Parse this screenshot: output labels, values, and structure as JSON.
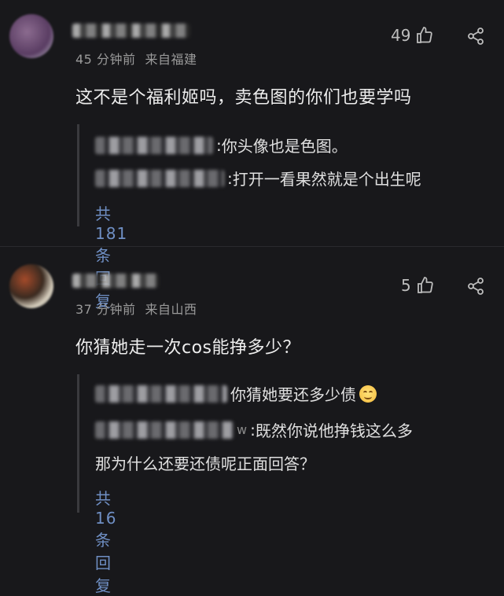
{
  "comments": [
    {
      "time": "45 分钟前",
      "location": "来自福建",
      "likes": "49",
      "text": "这不是个福利姬吗，卖色图的你们也要学吗",
      "replies": [
        {
          "text": "你头像也是色图。"
        },
        {
          "text": "打开一看果然就是个出生呢"
        }
      ],
      "more_replies": "共181条回复"
    },
    {
      "time": "37 分钟前",
      "location": "来自山西",
      "likes": "5",
      "text": "你猜她走一次cos能挣多少？",
      "replies": [
        {
          "text": "你猜她要还多少债"
        },
        {
          "suffix": "w",
          "text": "既然你说他挣钱这么多",
          "text_line2": "那为什么还要还债呢正面回答？"
        }
      ],
      "more_replies": "共16条回复"
    }
  ],
  "icons": {
    "like": "thumbs-up-icon",
    "share": "share-icon",
    "emoji": "smiling-face-emoji"
  },
  "colors": {
    "background": "#18181b",
    "link": "#6f8fc4",
    "meta": "#9a9a9a"
  }
}
